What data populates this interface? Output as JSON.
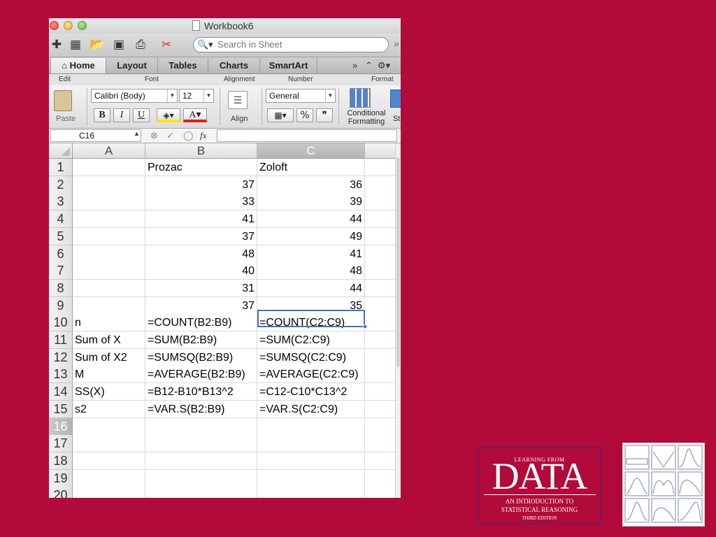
{
  "window": {
    "title": "Workbook6"
  },
  "toolbar": {
    "icons": [
      "new-icon",
      "gallery-icon",
      "open-icon",
      "save-icon",
      "print-icon",
      "cut-icon"
    ],
    "search_placeholder": "Search in Sheet"
  },
  "tabs": [
    "Home",
    "Layout",
    "Tables",
    "Charts",
    "SmartArt"
  ],
  "ribbon_groups": [
    "Edit",
    "Font",
    "Alignment",
    "Number",
    "Format"
  ],
  "ribbon": {
    "paste_label": "Paste",
    "font_name": "Calibri (Body)",
    "font_size": "12",
    "bold": "B",
    "italic": "I",
    "underline": "U",
    "font_color_glyph": "A",
    "align_label": "Align",
    "number_format": "General",
    "percent": "%",
    "comma": "❞",
    "conditional_formatting": "Conditional Formatting",
    "styles_truncated": "St"
  },
  "formula_bar": {
    "name_box": "C16",
    "fx": "fx"
  },
  "columns": [
    "A",
    "B",
    "C"
  ],
  "selected_cell": "C16",
  "sheet": {
    "rows": [
      {
        "n": "1",
        "a": "",
        "b": "Prozac",
        "c": "Zoloft"
      },
      {
        "n": "2",
        "a": "",
        "b": "37",
        "c": "36"
      },
      {
        "n": "3",
        "a": "",
        "b": "33",
        "c": "39"
      },
      {
        "n": "4",
        "a": "",
        "b": "41",
        "c": "44"
      },
      {
        "n": "5",
        "a": "",
        "b": "37",
        "c": "49"
      },
      {
        "n": "6",
        "a": "",
        "b": "48",
        "c": "41"
      },
      {
        "n": "7",
        "a": "",
        "b": "40",
        "c": "48"
      },
      {
        "n": "8",
        "a": "",
        "b": "31",
        "c": "44"
      },
      {
        "n": "9",
        "a": "",
        "b": "37",
        "c": "35"
      },
      {
        "n": "10",
        "a": "n",
        "b": "=COUNT(B2:B9)",
        "c": "=COUNT(C2:C9)"
      },
      {
        "n": "11",
        "a": "Sum of X",
        "b": "=SUM(B2:B9)",
        "c": "=SUM(C2:C9)"
      },
      {
        "n": "12",
        "a": "Sum of X2",
        "b": "=SUMSQ(B2:B9)",
        "c": "=SUMSQ(C2:C9)"
      },
      {
        "n": "13",
        "a": "M",
        "b": "=AVERAGE(B2:B9)",
        "c": "=AVERAGE(C2:C9)"
      },
      {
        "n": "14",
        "a": "SS(X)",
        "b": "=B12-B10*B13^2",
        "c": "=C12-C10*C13^2"
      },
      {
        "n": "15",
        "a": "s2",
        "b": "=VAR.S(B2:B9)",
        "c": "=VAR.S(C2:C9)"
      },
      {
        "n": "16",
        "a": "",
        "b": "",
        "c": ""
      },
      {
        "n": "17",
        "a": "",
        "b": "",
        "c": ""
      },
      {
        "n": "18",
        "a": "",
        "b": "",
        "c": ""
      },
      {
        "n": "19",
        "a": "",
        "b": "",
        "c": ""
      },
      {
        "n": "20",
        "a": "",
        "b": "",
        "c": ""
      }
    ]
  },
  "book_cover": {
    "top_line": "LEARNING FROM",
    "title": "DATA",
    "subtitle_1": "AN INTRODUCTION TO",
    "subtitle_2": "STATISTICAL REASONING",
    "edition": "THIRD EDITION"
  },
  "colors": {
    "background": "#b20a3a",
    "selection": "#3b73cc"
  }
}
